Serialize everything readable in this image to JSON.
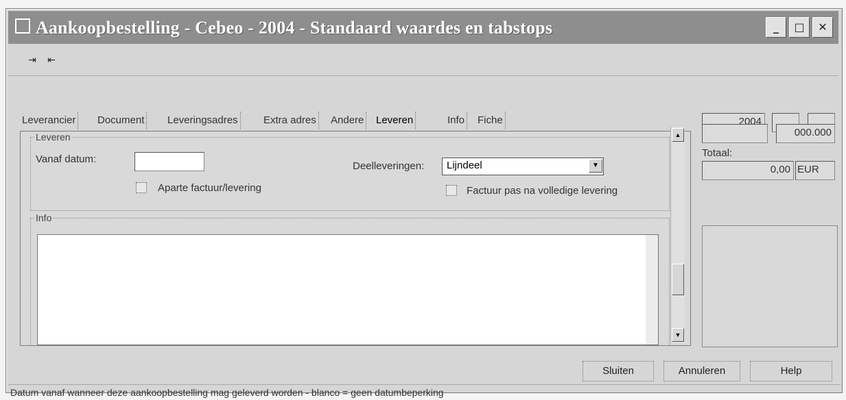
{
  "window": {
    "title": "Aankoopbestelling - Cebeo - 2004 - Standaard waardes en tabstops",
    "controls": [
      "minimize-icon",
      "maximize-icon",
      "close-icon"
    ]
  },
  "toolbar": {
    "tool1_icon": "tab-forward-icon",
    "tool2_icon": "tab-back-icon"
  },
  "tabs": [
    {
      "label": "Leverancier"
    },
    {
      "label": "Document"
    },
    {
      "label": "Leveringsadres"
    },
    {
      "label": "Extra adres"
    },
    {
      "label": "Andere"
    },
    {
      "label": "Leveren"
    },
    {
      "label": "Info"
    },
    {
      "label": "Fiche"
    }
  ],
  "leveren": {
    "group_title": "Leveren",
    "vanaf_label": "Vanaf datum:",
    "vanaf_value": "",
    "aparte_label": "Aparte factuur/levering",
    "deel_label": "Deelleveringen:",
    "deel_value": "Lijndeel",
    "factuur_label": "Factuur pas na volledige levering"
  },
  "info": {
    "group_title": "Info",
    "text": ""
  },
  "side": {
    "year": "2004",
    "number": "000.000",
    "totaal_label": "Totaal:",
    "totaal_value": "0,00",
    "currency": "EUR"
  },
  "buttons": {
    "sluiten": "Sluiten",
    "annuleren": "Annuleren",
    "help": "Help"
  },
  "status": "Datum vanaf wanneer deze aankoopbestelling mag geleverd worden - blanco = geen datumbeperking"
}
